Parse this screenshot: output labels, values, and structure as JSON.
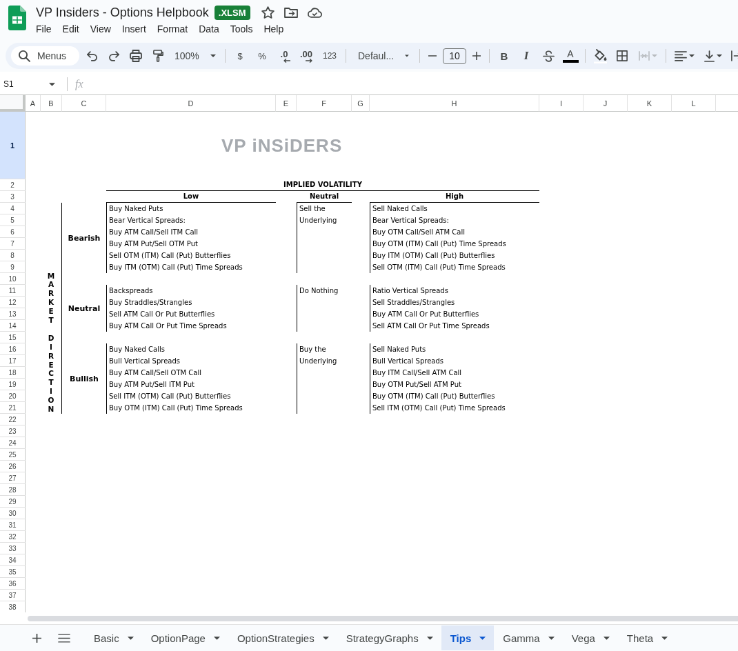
{
  "app_header": {
    "title": "VP Insiders - Options Helpbook",
    "file_badge": ".XLSM"
  },
  "menu": [
    "File",
    "Edit",
    "View",
    "Insert",
    "Format",
    "Data",
    "Tools",
    "Help"
  ],
  "toolbar": {
    "groups": [
      [
        {
          "kind": "search",
          "label": "Menus",
          "disabled": false
        },
        {
          "kind": "undo",
          "disabled": false
        },
        {
          "kind": "redo",
          "disabled": false
        },
        {
          "kind": "print",
          "disabled": false
        },
        {
          "kind": "paintformat",
          "disabled": false
        },
        {
          "kind": "zoom",
          "label": "100%",
          "disabled": false
        }
      ],
      [
        {
          "kind": "currency",
          "label": "$",
          "disabled": false
        },
        {
          "kind": "percent",
          "label": "%",
          "disabled": false
        },
        {
          "kind": "decimaldown",
          "label": ".0",
          "disabled": false
        },
        {
          "kind": "decimalup",
          "label": ".00",
          "disabled": false
        },
        {
          "kind": "numberformat",
          "label": "123",
          "disabled": false
        }
      ],
      [
        {
          "kind": "font",
          "label": "Defaul...",
          "disabled": false
        }
      ],
      [
        {
          "kind": "minus",
          "disabled": false
        },
        {
          "kind": "sizefield",
          "value": "10",
          "disabled": false
        },
        {
          "kind": "plus",
          "disabled": false
        }
      ],
      [
        {
          "kind": "bold",
          "label": "B",
          "disabled": false
        },
        {
          "kind": "italic",
          "label": "I",
          "disabled": false
        },
        {
          "kind": "strikethrough",
          "disabled": false
        },
        {
          "kind": "textcolor",
          "label": "A",
          "disabled": false
        }
      ],
      [
        {
          "kind": "fillcolor",
          "disabled": false
        },
        {
          "kind": "borders",
          "disabled": false
        },
        {
          "kind": "merge",
          "disabled": true
        }
      ],
      [
        {
          "kind": "align",
          "disabled": false
        },
        {
          "kind": "valign",
          "disabled": false
        },
        {
          "kind": "wrap",
          "disabled": false
        }
      ]
    ]
  },
  "formula_bar": {
    "name_box": "S1",
    "function_label": "fx"
  },
  "sheet": {
    "columns": [
      "A",
      "B",
      "C",
      "D",
      "E",
      "F",
      "G",
      "H",
      "I",
      "J",
      "K",
      "L"
    ],
    "rows": [
      {
        "label": "1",
        "selected": true
      },
      {
        "label": "2",
        "selected": false
      },
      {
        "label": "3",
        "selected": false
      },
      {
        "label": "4",
        "selected": false
      },
      {
        "label": "5",
        "selected": false
      },
      {
        "label": "6",
        "selected": false
      },
      {
        "label": "7",
        "selected": false
      },
      {
        "label": "8",
        "selected": false
      },
      {
        "label": "9",
        "selected": false
      },
      {
        "label": "10",
        "selected": false
      },
      {
        "label": "11",
        "selected": false
      },
      {
        "label": "12",
        "selected": false
      },
      {
        "label": "13",
        "selected": false
      },
      {
        "label": "14",
        "selected": false
      },
      {
        "label": "15",
        "selected": false
      },
      {
        "label": "16",
        "selected": false
      },
      {
        "label": "17",
        "selected": false
      },
      {
        "label": "18",
        "selected": false
      },
      {
        "label": "19",
        "selected": false
      },
      {
        "label": "20",
        "selected": false
      },
      {
        "label": "21",
        "selected": false
      },
      {
        "label": "22",
        "selected": false
      },
      {
        "label": "23",
        "selected": false
      },
      {
        "label": "24",
        "selected": false
      },
      {
        "label": "25",
        "selected": false
      },
      {
        "label": "26",
        "selected": false
      },
      {
        "label": "27",
        "selected": false
      },
      {
        "label": "28",
        "selected": false
      },
      {
        "label": "29",
        "selected": false
      },
      {
        "label": "30",
        "selected": false
      },
      {
        "label": "31",
        "selected": false
      },
      {
        "label": "32",
        "selected": false
      },
      {
        "label": "33",
        "selected": false
      },
      {
        "label": "34",
        "selected": false
      },
      {
        "label": "35",
        "selected": false
      },
      {
        "label": "36",
        "selected": false
      },
      {
        "label": "37",
        "selected": false
      },
      {
        "label": "38",
        "selected": false
      }
    ],
    "logo": "VP iNSiDERS",
    "matrix": {
      "title": "IMPLIED VOLATILITY",
      "columns": [
        "Low",
        "Neutral",
        "High"
      ],
      "axis_label": "MARKET DIRECTION",
      "groups": [
        {
          "label": "Bearish",
          "cells": [
            [
              "Buy Naked Puts",
              "Bear Vertical Spreads:",
              "Buy ATM Call/Sell ITM Call",
              "Buy ATM Put/Sell OTM Put",
              "Sell OTM (ITM) Call (Put) Butterflies",
              "Buy ITM (OTM) Call (Put) Time Spreads"
            ],
            [
              "Sell the Underlying"
            ],
            [
              "Sell Naked Calls",
              "Bear Vertical Spreads:",
              "Buy OTM Call/Sell ATM Call",
              "Buy OTM (ITM) Call (Put) Time Spreads",
              "Buy ITM (OTM) Call (Put) Butterflies",
              "Sell OTM (ITM) Call (Put) Time Spreads"
            ]
          ]
        },
        {
          "label": "Neutral",
          "cells": [
            [
              "Backspreads",
              "Buy Straddles/Strangles",
              "Sell ATM Call Or Put Butterflies",
              "Buy ATM Call Or Put Time Spreads"
            ],
            [
              "Do Nothing"
            ],
            [
              "Ratio Vertical Spreads",
              "Sell Straddles/Strangles",
              "Buy ATM Call Or Put Butterflies",
              "Sell ATM Call Or Put Time Spreads"
            ]
          ]
        },
        {
          "label": "Bullish",
          "cells": [
            [
              "Buy Naked Calls",
              "Bull Vertical Spreads",
              "Buy ATM Call/Sell OTM Call",
              "Buy ATM Put/Sell ITM Put",
              "Sell ITM (OTM) Call (Put) Butterflies",
              "Buy OTM (ITM) Call (Put) Time Spreads"
            ],
            [
              "Buy the Underlying"
            ],
            [
              "Sell Naked Puts",
              "Bull Vertical Spreads",
              "Buy ITM Call/Sell ATM Call",
              "Buy OTM Put/Sell ATM Put",
              "Buy OTM (ITM) Call (Put) Butterflies",
              "Sell ITM (OTM) Call (Put) Time Spreads"
            ]
          ]
        }
      ]
    }
  },
  "sheet_tabs": [
    {
      "label": "Basic",
      "selected": false
    },
    {
      "label": "OptionPage",
      "selected": false
    },
    {
      "label": "OptionStrategies",
      "selected": false
    },
    {
      "label": "StrategyGraphs",
      "selected": false
    },
    {
      "label": "Tips",
      "selected": true
    },
    {
      "label": "Gamma",
      "selected": false
    },
    {
      "label": "Vega",
      "selected": false
    },
    {
      "label": "Theta",
      "selected": false
    }
  ]
}
